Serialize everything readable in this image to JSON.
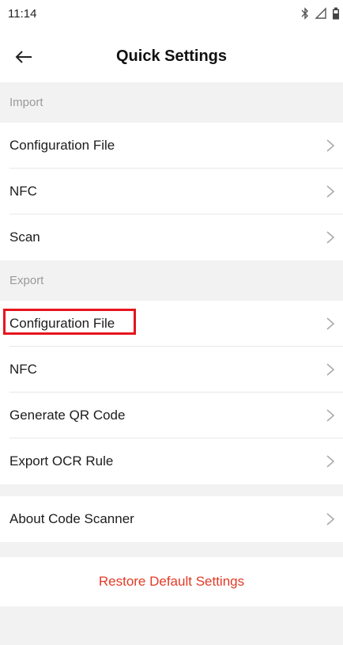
{
  "status_bar": {
    "time": "11:14",
    "icons": [
      "bluetooth-icon",
      "signal-icon",
      "battery-icon"
    ]
  },
  "header": {
    "title": "Quick Settings",
    "back_icon": "arrow-left-icon"
  },
  "sections": {
    "import": {
      "title": "Import",
      "items": [
        "Configuration File",
        "NFC",
        "Scan"
      ]
    },
    "export": {
      "title": "Export",
      "items": [
        "Configuration File",
        "NFC",
        "Generate QR Code",
        "Export OCR Rule"
      ]
    },
    "about": {
      "items": [
        "About Code Scanner"
      ]
    }
  },
  "restore_button": {
    "label": "Restore Default Settings",
    "color": "#e23a26"
  },
  "highlight": {
    "target": "Configuration File",
    "color": "#e6141e"
  }
}
